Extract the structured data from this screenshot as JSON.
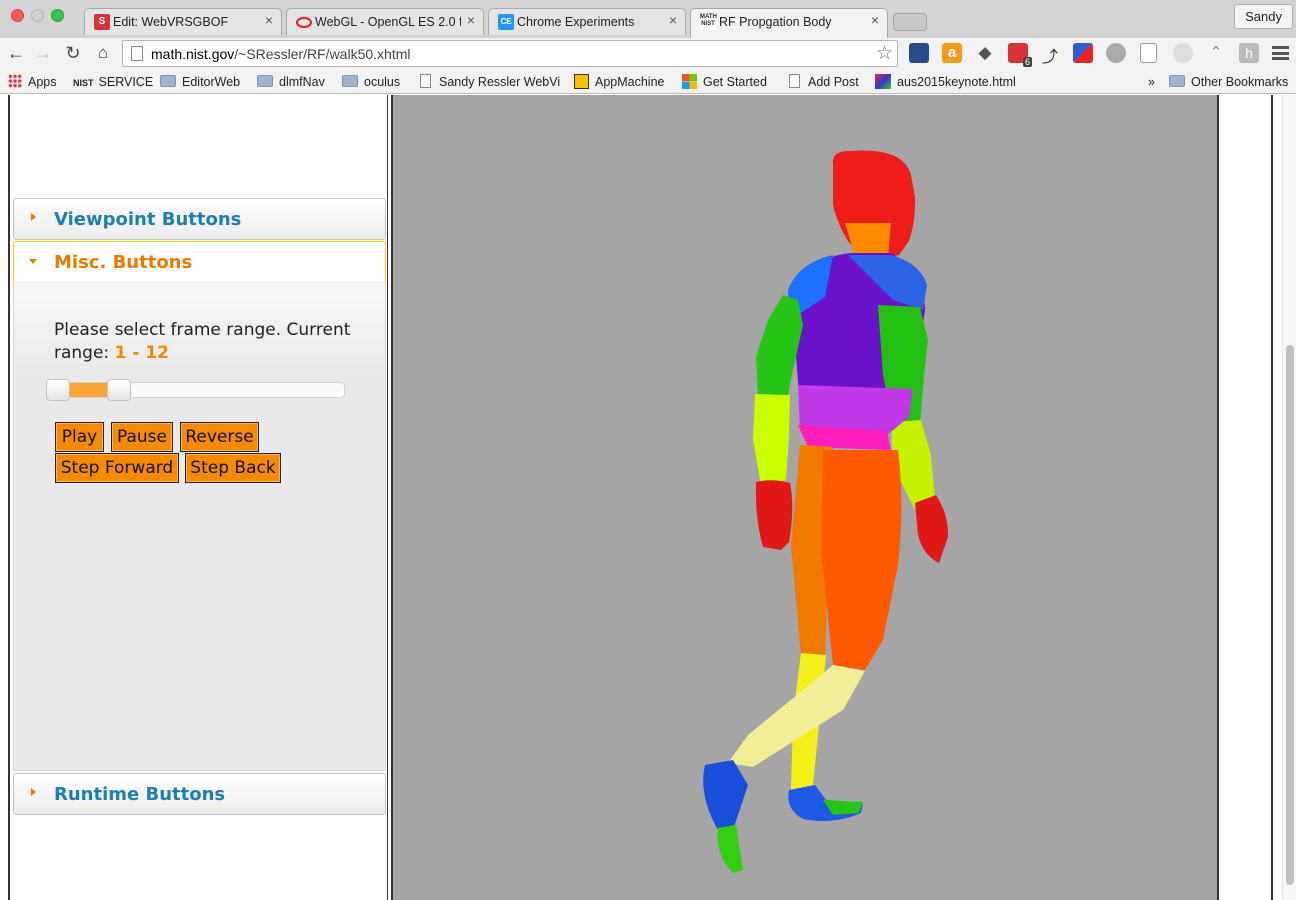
{
  "browser": {
    "tabs": [
      {
        "title": "Edit: WebVRSGBOF",
        "icon_color": "#d9323a",
        "icon_text": "S"
      },
      {
        "title": "WebGL - OpenGL ES 2.0 fo",
        "icon_color": "#d81e1e",
        "icon_text": ""
      },
      {
        "title": "Chrome Experiments",
        "icon_color": "#2196f3",
        "icon_text": "CE"
      },
      {
        "title": "RF Propgation Body",
        "icon_color": "#333333",
        "icon_text": "N"
      }
    ],
    "active_tab": 3,
    "profile_name": "Sandy",
    "url_host": "math.nist.gov",
    "url_path": "/~SRessler/RF/walk50.xhtml",
    "extension_badge": "6",
    "bookmarks": [
      {
        "label": "Apps",
        "icon": "apps-grid-icon"
      },
      {
        "label": "SERVICE",
        "icon": "nist-icon"
      },
      {
        "label": "EditorWeb",
        "icon": "folder-icon"
      },
      {
        "label": "dlmfNav",
        "icon": "folder-icon"
      },
      {
        "label": "oculus",
        "icon": "folder-icon"
      },
      {
        "label": "Sandy Ressler WebVi",
        "icon": "page-icon"
      },
      {
        "label": "AppMachine",
        "icon": "appmachine-icon"
      },
      {
        "label": "Get Started",
        "icon": "windows-icon"
      },
      {
        "label": "Add Post",
        "icon": "page-icon"
      },
      {
        "label": "aus2015keynote.html",
        "icon": "image-icon"
      }
    ],
    "bookmarks_overflow": "»",
    "other_bookmarks": "Other Bookmarks"
  },
  "panel": {
    "sections": {
      "viewpoint": "Viewpoint Buttons",
      "misc": "Misc. Buttons",
      "runtime": "Runtime Buttons"
    },
    "frame_prompt": "Please select frame range. Current range:",
    "range_display": "1 - 12",
    "range": {
      "min": 1,
      "max": 50,
      "low": 1,
      "high": 12
    },
    "buttons": {
      "play": "Play",
      "pause": "Pause",
      "reverse": "Reverse",
      "step_forward": "Step Forward",
      "step_back": "Step Back"
    }
  },
  "colors": {
    "accent_orange": "#f58a00",
    "header_blue": "#1b7fb6",
    "viewport_bg": "#a5a5a5"
  }
}
